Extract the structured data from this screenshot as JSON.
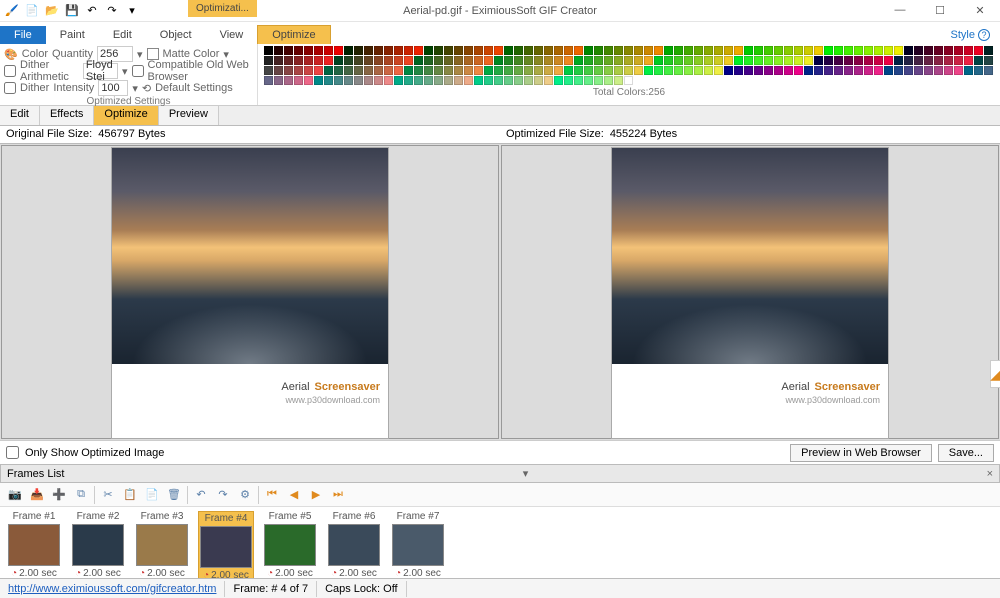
{
  "window": {
    "title": "Aerial-pd.gif - EximiousSoft GIF Creator",
    "style_label": "Style"
  },
  "ribbon": {
    "context_header": "Optimizati...",
    "tabs": {
      "file": "File",
      "paint": "Paint",
      "edit": "Edit",
      "object": "Object",
      "view": "View",
      "optimize": "Optimize"
    }
  },
  "optimize": {
    "color_label": "Color",
    "quantity_label": "Quantity",
    "quantity_value": "256",
    "matte_label": "Matte Color",
    "dither_arith_label": "Dither Arithmetic",
    "dither_arith_value": "Floyd Stei",
    "compat_label": "Compatible Old Web Browser",
    "dither_label": "Dither",
    "intensity_label": "Intensity",
    "intensity_value": "100",
    "default_label": "Default Settings",
    "group_caption": "Optimized Settings"
  },
  "palette": {
    "caption": "Total Colors:256"
  },
  "subtabs": {
    "edit": "Edit",
    "effects": "Effects",
    "optimize": "Optimize",
    "preview": "Preview"
  },
  "sizes": {
    "orig_label": "Original File Size:",
    "orig_value": "456797 Bytes",
    "opt_label": "Optimized File Size:",
    "opt_value": "455224 Bytes"
  },
  "image_caption": {
    "word1": "Aerial",
    "word2": "Screensaver",
    "sub": "www.p30download.com"
  },
  "controls": {
    "only_opt": "Only Show Optimized Image",
    "preview_btn": "Preview in Web Browser",
    "save_btn": "Save..."
  },
  "frames": {
    "header": "Frames List",
    "items": [
      {
        "label": "Frame #1",
        "dur": "2.00 sec",
        "bg": "#8a5a3a"
      },
      {
        "label": "Frame #2",
        "dur": "2.00 sec",
        "bg": "#2a3a4a"
      },
      {
        "label": "Frame #3",
        "dur": "2.00 sec",
        "bg": "#9a7a4a"
      },
      {
        "label": "Frame #4",
        "dur": "2.00 sec",
        "bg": "#3a3a50"
      },
      {
        "label": "Frame #5",
        "dur": "2.00 sec",
        "bg": "#2a6a2a"
      },
      {
        "label": "Frame #6",
        "dur": "2.00 sec",
        "bg": "#3a4a5a"
      },
      {
        "label": "Frame #7",
        "dur": "2.00 sec",
        "bg": "#4a5a6a"
      }
    ],
    "selected_index": 3
  },
  "status": {
    "url": "http://www.eximioussoft.com/gifcreator.htm",
    "frame": "Frame: # 4 of 7",
    "caps": "Caps Lock: Off"
  },
  "palette_colors": [
    "#000",
    "#200",
    "#400",
    "#600",
    "#800",
    "#a00",
    "#c00",
    "#e00",
    "#020",
    "#220",
    "#420",
    "#620",
    "#820",
    "#a20",
    "#c20",
    "#e20",
    "#040",
    "#240",
    "#440",
    "#640",
    "#840",
    "#a40",
    "#c40",
    "#e40",
    "#060",
    "#260",
    "#460",
    "#660",
    "#860",
    "#a60",
    "#c60",
    "#e60",
    "#080",
    "#280",
    "#480",
    "#680",
    "#880",
    "#a80",
    "#c80",
    "#e80",
    "#0a0",
    "#2a0",
    "#4a0",
    "#6a0",
    "#8a0",
    "#aa0",
    "#ca0",
    "#ea0",
    "#0c0",
    "#2c0",
    "#4c0",
    "#6c0",
    "#8c0",
    "#ac0",
    "#cc0",
    "#ec0",
    "#0e0",
    "#2e0",
    "#4e0",
    "#6e0",
    "#8e0",
    "#ae0",
    "#ce0",
    "#ee0",
    "#002",
    "#202",
    "#402",
    "#602",
    "#802",
    "#a02",
    "#c02",
    "#e02",
    "#022",
    "#222",
    "#422",
    "#622",
    "#822",
    "#a22",
    "#c22",
    "#e22",
    "#042",
    "#242",
    "#442",
    "#642",
    "#842",
    "#a42",
    "#c42",
    "#e42",
    "#062",
    "#262",
    "#462",
    "#662",
    "#862",
    "#a62",
    "#c62",
    "#e62",
    "#082",
    "#282",
    "#482",
    "#682",
    "#882",
    "#a82",
    "#c82",
    "#e82",
    "#0a2",
    "#2a2",
    "#4a2",
    "#6a2",
    "#8a2",
    "#aa2",
    "#ca2",
    "#ea2",
    "#0c2",
    "#2c2",
    "#4c2",
    "#6c2",
    "#8c2",
    "#ac2",
    "#cc2",
    "#ec2",
    "#0e2",
    "#2e2",
    "#4e2",
    "#6e2",
    "#8e2",
    "#ae2",
    "#ce2",
    "#ee2",
    "#004",
    "#204",
    "#404",
    "#604",
    "#804",
    "#a04",
    "#c04",
    "#e04",
    "#024",
    "#224",
    "#424",
    "#624",
    "#824",
    "#a24",
    "#c24",
    "#e24",
    "#044",
    "#244",
    "#444",
    "#644",
    "#844",
    "#a44",
    "#c44",
    "#e44",
    "#064",
    "#264",
    "#464",
    "#664",
    "#864",
    "#a64",
    "#c64",
    "#e64",
    "#084",
    "#284",
    "#484",
    "#684",
    "#884",
    "#a84",
    "#c84",
    "#e84",
    "#0a4",
    "#2a4",
    "#4a4",
    "#6a4",
    "#8a4",
    "#aa4",
    "#ca4",
    "#ea4",
    "#0c4",
    "#2c4",
    "#4c4",
    "#6c4",
    "#8c4",
    "#ac4",
    "#cc4",
    "#ec4",
    "#0e4",
    "#2e4",
    "#4e4",
    "#6e4",
    "#8e4",
    "#ae4",
    "#ce4",
    "#ee4",
    "#008",
    "#208",
    "#408",
    "#608",
    "#808",
    "#a08",
    "#c08",
    "#e08",
    "#028",
    "#228",
    "#428",
    "#628",
    "#828",
    "#a28",
    "#c28",
    "#e28",
    "#048",
    "#248",
    "#448",
    "#648",
    "#848",
    "#a48",
    "#c48",
    "#e48",
    "#068",
    "#268",
    "#468",
    "#668",
    "#868",
    "#a68",
    "#c68",
    "#e68",
    "#088",
    "#288",
    "#488",
    "#688",
    "#888",
    "#a88",
    "#c88",
    "#e88",
    "#0a8",
    "#2a8",
    "#4a8",
    "#6a8",
    "#8a8",
    "#aa8",
    "#ca8",
    "#ea8",
    "#0c8",
    "#2c8",
    "#4c8",
    "#6c8",
    "#8c8",
    "#ac8",
    "#cc8",
    "#ec8",
    "#0e8",
    "#2e8",
    "#4e8",
    "#6e8",
    "#8e8",
    "#ae8",
    "#ce8",
    "#fff"
  ]
}
